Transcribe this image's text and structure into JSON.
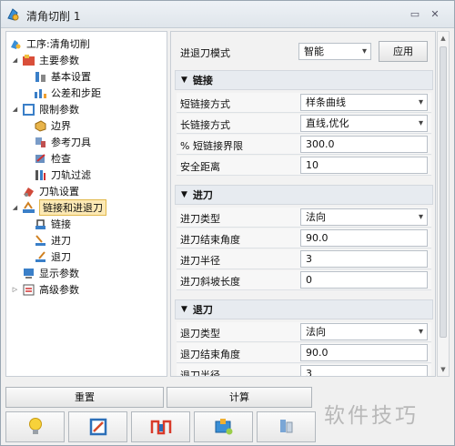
{
  "window": {
    "title": "清角切削 1"
  },
  "tree": {
    "root": "工序:清角切削",
    "items": [
      {
        "label": "主要参数"
      },
      {
        "label": "基本设置"
      },
      {
        "label": "公差和步距"
      },
      {
        "label": "限制参数"
      },
      {
        "label": "边界"
      },
      {
        "label": "参考刀具"
      },
      {
        "label": "检查"
      },
      {
        "label": "刀轨过滤"
      },
      {
        "label": "刀轨设置"
      },
      {
        "label": "链接和进退刀"
      },
      {
        "label": "链接"
      },
      {
        "label": "进刀"
      },
      {
        "label": "退刀"
      },
      {
        "label": "显示参数"
      },
      {
        "label": "高级参数"
      }
    ]
  },
  "props": {
    "mode": {
      "label": "进退刀模式",
      "value": "智能",
      "apply": "应用"
    },
    "link": {
      "title": "链接",
      "rows": [
        {
          "label": "短链接方式",
          "value": "样条曲线"
        },
        {
          "label": "长链接方式",
          "value": "直线,优化"
        },
        {
          "label": "% 短链接界限",
          "value": "300.0"
        },
        {
          "label": "安全距离",
          "value": "10"
        }
      ]
    },
    "enter": {
      "title": "进刀",
      "rows": [
        {
          "label": "进刀类型",
          "value": "法向"
        },
        {
          "label": "进刀结束角度",
          "value": "90.0"
        },
        {
          "label": "进刀半径",
          "value": "3"
        },
        {
          "label": "进刀斜坡长度",
          "value": "0"
        }
      ]
    },
    "exit": {
      "title": "退刀",
      "rows": [
        {
          "label": "退刀类型",
          "value": "法向"
        },
        {
          "label": "退刀结束角度",
          "value": "90.0"
        },
        {
          "label": "退刀半径",
          "value": "3"
        }
      ]
    }
  },
  "buttons": {
    "reset": "重置",
    "calc": "计算"
  },
  "watermark": "软件技巧"
}
